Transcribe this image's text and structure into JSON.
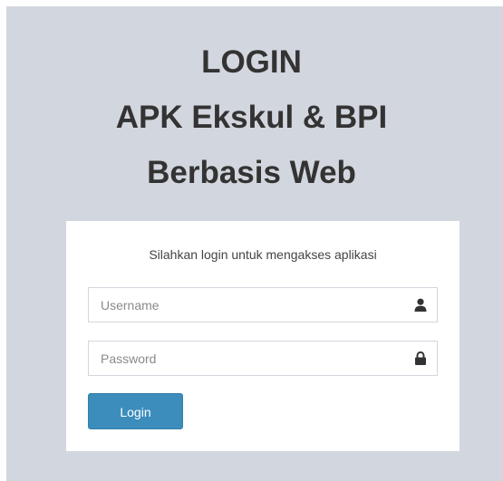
{
  "header": {
    "title_lines": [
      "LOGIN",
      "APK Ekskul & BPI",
      "Berbasis Web"
    ]
  },
  "login_box": {
    "message": "Silahkan login untuk mengakses aplikasi",
    "username": {
      "placeholder": "Username",
      "value": "",
      "icon": "user-icon"
    },
    "password": {
      "placeholder": "Password",
      "value": "",
      "icon": "lock-icon"
    },
    "submit_label": "Login"
  },
  "colors": {
    "background": "#d2d6de",
    "box": "#ffffff",
    "button": "#3c8dbc",
    "title_text": "#333333"
  }
}
